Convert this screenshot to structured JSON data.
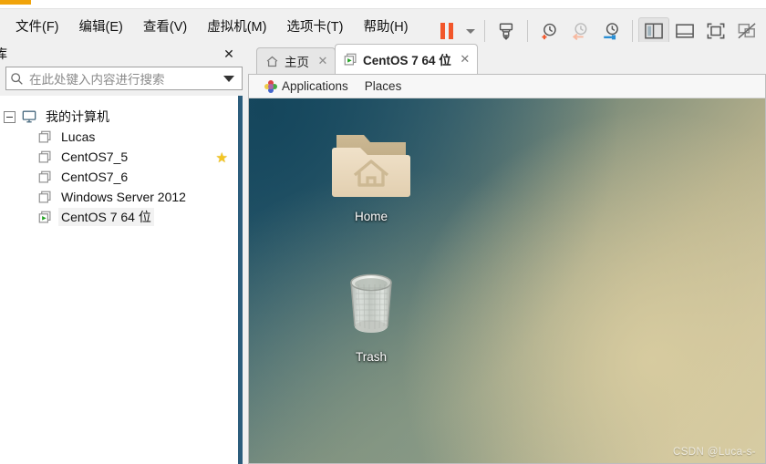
{
  "window": {
    "accent_orange": "#f0a30a"
  },
  "menubar": {
    "items": [
      {
        "label": "文件(F)",
        "name": "menu-file"
      },
      {
        "label": "编辑(E)",
        "name": "menu-edit"
      },
      {
        "label": "查看(V)",
        "name": "menu-view"
      },
      {
        "label": "虚拟机(M)",
        "name": "menu-vm"
      },
      {
        "label": "选项卡(T)",
        "name": "menu-tabs"
      },
      {
        "label": "帮助(H)",
        "name": "menu-help"
      }
    ]
  },
  "toolbar": {
    "pause_color": "#f2562a",
    "items": [
      {
        "name": "pause-vm-button",
        "icon": "pause-icon"
      },
      {
        "name": "power-dropdown-button",
        "icon": "chevron-down-icon"
      },
      {
        "name": "send-ctrl-alt-del-button",
        "icon": "snapshot-manage-icon"
      },
      {
        "name": "take-snapshot-button",
        "icon": "snapshot-add-icon"
      },
      {
        "name": "revert-snapshot-button",
        "icon": "snapshot-revert-icon"
      },
      {
        "name": "snapshot-manager-button",
        "icon": "snapshot-wrench-icon"
      },
      {
        "name": "show-library-button",
        "icon": "library-panel-icon"
      },
      {
        "name": "show-thumbnail-bar-button",
        "icon": "thumbnail-bar-icon"
      },
      {
        "name": "enter-fullscreen-button",
        "icon": "fullscreen-icon"
      },
      {
        "name": "unity-mode-button",
        "icon": "unity-mode-icon"
      }
    ]
  },
  "sidebar": {
    "title": "库",
    "close_label": "✕",
    "search": {
      "placeholder": "在此处键入内容进行搜索",
      "value": ""
    },
    "tree": {
      "root": "我的计算机",
      "items": [
        {
          "label": "Lucas",
          "state": "stopped",
          "favorite": false
        },
        {
          "label": "CentOS7_5",
          "state": "stopped",
          "favorite": true
        },
        {
          "label": "CentOS7_6",
          "state": "stopped",
          "favorite": false
        },
        {
          "label": "Windows Server 2012",
          "state": "stopped",
          "favorite": false
        },
        {
          "label": "CentOS 7 64 位",
          "state": "running",
          "favorite": false
        }
      ]
    }
  },
  "tabs": [
    {
      "label": "主页",
      "icon": "home-icon",
      "active": false,
      "close_label": "✕"
    },
    {
      "label": "CentOS 7 64 位",
      "icon": "vm-running-icon",
      "active": true,
      "close_label": "✕"
    }
  ],
  "guest": {
    "panel": {
      "applications": "Applications",
      "places": "Places"
    },
    "desktop_icons": [
      {
        "label": "Home",
        "icon": "home-folder-icon"
      },
      {
        "label": "Trash",
        "icon": "trash-can-icon"
      }
    ],
    "watermark": "CSDN @Luca-s-"
  }
}
